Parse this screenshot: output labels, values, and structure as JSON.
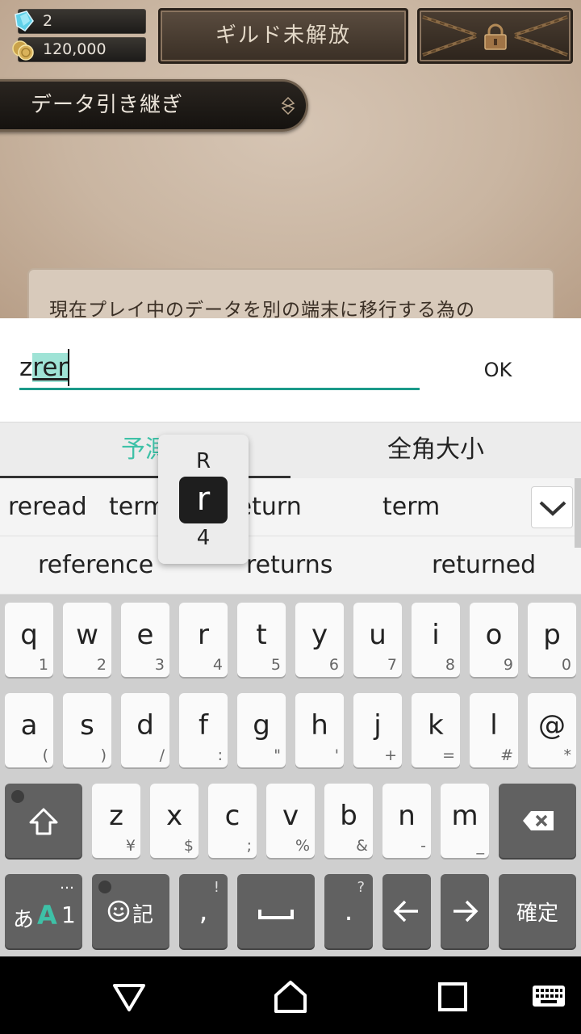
{
  "game": {
    "gem_count": "2",
    "coin_count": "120,000",
    "guild_button_label": "ギルド未解放",
    "section_title": "データ引き継ぎ",
    "info_text": "現在プレイ中のデータを別の端末に移行する為の"
  },
  "input": {
    "typed_text": "z",
    "composing_text": "rer",
    "ok_label": "OK"
  },
  "ime": {
    "tabs": [
      "予測",
      "全角大小"
    ],
    "candidates_row1": [
      "reread",
      "term",
      "return",
      "term"
    ],
    "candidates_row2": [
      "reference",
      "returns",
      "returned"
    ],
    "key_preview": {
      "top": "R",
      "main": "r",
      "bottom": "4"
    }
  },
  "keyboard": {
    "row1": [
      {
        "main": "q",
        "sub": "1"
      },
      {
        "main": "w",
        "sub": "2"
      },
      {
        "main": "e",
        "sub": "3"
      },
      {
        "main": "r",
        "sub": "4"
      },
      {
        "main": "t",
        "sub": "5"
      },
      {
        "main": "y",
        "sub": "6"
      },
      {
        "main": "u",
        "sub": "7"
      },
      {
        "main": "i",
        "sub": "8"
      },
      {
        "main": "o",
        "sub": "9"
      },
      {
        "main": "p",
        "sub": "0"
      }
    ],
    "row2": [
      {
        "main": "a",
        "sub": "("
      },
      {
        "main": "s",
        "sub": ")"
      },
      {
        "main": "d",
        "sub": "/"
      },
      {
        "main": "f",
        "sub": ":"
      },
      {
        "main": "g",
        "sub": "\""
      },
      {
        "main": "h",
        "sub": "'"
      },
      {
        "main": "j",
        "sub": "+"
      },
      {
        "main": "k",
        "sub": "="
      },
      {
        "main": "l",
        "sub": "#"
      },
      {
        "main": "@",
        "sub": "*"
      }
    ],
    "row3": [
      {
        "main": "z",
        "sub": "¥"
      },
      {
        "main": "x",
        "sub": "$"
      },
      {
        "main": "c",
        "sub": ";"
      },
      {
        "main": "v",
        "sub": "%"
      },
      {
        "main": "b",
        "sub": "&"
      },
      {
        "main": "n",
        "sub": "-"
      },
      {
        "main": "m",
        "sub": "_"
      }
    ],
    "mode_label_a": "あ",
    "mode_label_b": "A",
    "mode_label_c": "1",
    "mode_dots": "…",
    "emoji_label": "記",
    "comma": {
      "main": ",",
      "sub": "!"
    },
    "period": {
      "main": ".",
      "sub": "?"
    },
    "confirm_label": "確定"
  },
  "colors": {
    "accent": "#1b9a8a",
    "composing_bg": "#9fe3d6",
    "tab_active": "#3ec1a7",
    "key_dark": "#616161"
  }
}
